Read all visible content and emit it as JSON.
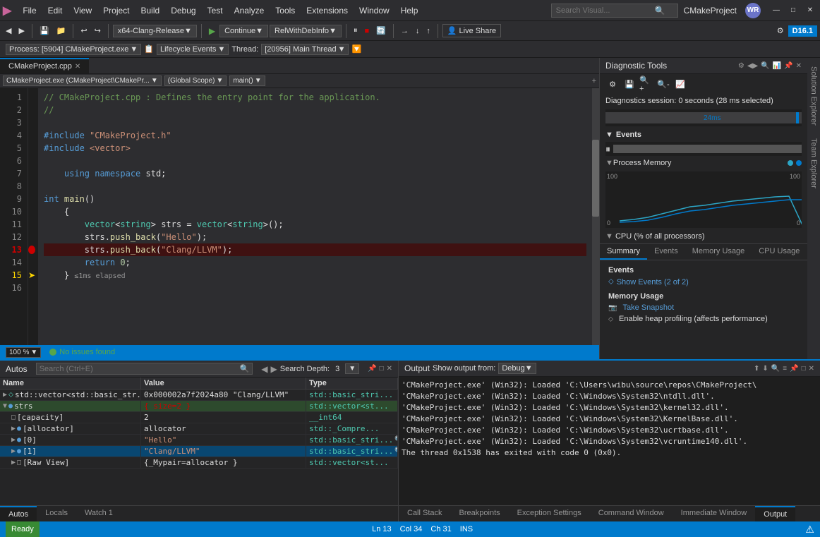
{
  "app": {
    "logo": "▶",
    "title": "CMakeProject",
    "user_initials": "WR"
  },
  "menu": {
    "items": [
      "File",
      "Edit",
      "View",
      "Project",
      "Build",
      "Debug",
      "Test",
      "Analyze",
      "Tools",
      "Extensions",
      "Window",
      "Help"
    ]
  },
  "search": {
    "placeholder": "Search Visual...",
    "value": ""
  },
  "toolbar": {
    "platform": "x64-Clang-Release",
    "continue": "Continue",
    "rel_with_deb": "RelWithDebInfo",
    "live_share": "Live Share",
    "d16": "D16.1"
  },
  "process_bar": {
    "process": "Process: [5904] CMakeProject.exe",
    "lifecycle": "Lifecycle Events",
    "thread_label": "Thread:",
    "thread": "[20956] Main Thread"
  },
  "editor": {
    "tab_name": "CMakeProject.cpp",
    "file_path": "CMakeProject.exe (CMakeProject\\CMakePr...",
    "scope": "(Global Scope)",
    "func": "main()",
    "lines": [
      {
        "num": 1,
        "text": "// CMakeProject.cpp : Defines the entry point for the application.",
        "type": "comment"
      },
      {
        "num": 2,
        "text": "//",
        "type": "comment"
      },
      {
        "num": 3,
        "text": "",
        "type": "normal"
      },
      {
        "num": 4,
        "text": "#include \"CMakeProject.h\"",
        "type": "include"
      },
      {
        "num": 5,
        "text": "#include <vector>",
        "type": "include"
      },
      {
        "num": 6,
        "text": "",
        "type": "normal"
      },
      {
        "num": 7,
        "text": "    using namespace std;",
        "type": "normal"
      },
      {
        "num": 8,
        "text": "",
        "type": "normal"
      },
      {
        "num": 9,
        "text": "int main()",
        "type": "normal"
      },
      {
        "num": 10,
        "text": "    {",
        "type": "normal"
      },
      {
        "num": 11,
        "text": "        vector<string> strs = vector<string>();",
        "type": "normal"
      },
      {
        "num": 12,
        "text": "        strs.push_back(\"Hello\");",
        "type": "normal"
      },
      {
        "num": 13,
        "text": "        strs.push_back(\"Clang/LLVM\");",
        "type": "breakpoint"
      },
      {
        "num": 14,
        "text": "        return 0;",
        "type": "normal"
      },
      {
        "num": 15,
        "text": "    } ≤1ms elapsed",
        "type": "timing"
      },
      {
        "num": 16,
        "text": "",
        "type": "normal"
      }
    ],
    "zoom": "100 %",
    "status": "No issues found",
    "ln": "Ln 13",
    "col": "Col 34",
    "ch": "Ch 31",
    "ins": "INS"
  },
  "diagnostic": {
    "title": "Diagnostic Tools",
    "session": "Diagnostics session: 0 seconds (28 ms selected)",
    "time_marker": "24ms",
    "events_section": "Events",
    "process_memory_section": "Process Memory",
    "cpu_section": "CPU (% of all processors)",
    "mem_high_left": "100",
    "mem_low_left": "0",
    "mem_high_right": "100",
    "mem_low_right": "0",
    "tabs": [
      "Summary",
      "Events",
      "Memory Usage",
      "CPU Usage"
    ],
    "active_tab": "Summary",
    "events_label": "Events",
    "show_events": "Show Events (2 of 2)",
    "memory_usage_label": "Memory Usage",
    "take_snapshot": "Take Snapshot",
    "enable_heap": "Enable heap profiling (affects performance)"
  },
  "autos": {
    "title": "Autos",
    "search_placeholder": "Search (Ctrl+E)",
    "search_depth_label": "Search Depth:",
    "search_depth_value": "3",
    "columns": [
      "Name",
      "Value",
      "Type"
    ],
    "rows": [
      {
        "indent": 0,
        "expand": true,
        "icon": "ptr",
        "name": "std::vector<std::basic_str...",
        "value": "0x000002a7f2024a80 \"Clang/LLVM\"",
        "type": "std::basic_stri...",
        "has_search": true,
        "selected": false,
        "highlighted": false
      },
      {
        "indent": 0,
        "expand": true,
        "icon": "obj",
        "name": "strs",
        "value": "{ size=2 }",
        "type": "std::vector<st...",
        "has_search": false,
        "selected": false,
        "highlighted": true
      },
      {
        "indent": 1,
        "expand": false,
        "icon": "item",
        "name": "[capacity]",
        "value": "2",
        "type": "__int64",
        "has_search": false,
        "selected": false,
        "highlighted": false
      },
      {
        "indent": 1,
        "expand": false,
        "icon": "obj",
        "name": "[allocator]",
        "value": "allocator",
        "type": "std::_Compre...",
        "has_search": false,
        "selected": false,
        "highlighted": false
      },
      {
        "indent": 1,
        "expand": false,
        "icon": "obj",
        "name": "[0]",
        "value": "\"Hello\"",
        "type": "std::basic_stri...",
        "has_search": true,
        "selected": false,
        "highlighted": false
      },
      {
        "indent": 1,
        "expand": false,
        "icon": "obj",
        "name": "[1]",
        "value": "\"Clang/LLVM\"",
        "type": "std::basic_stri...",
        "has_search": true,
        "selected": true,
        "highlighted": false
      },
      {
        "indent": 1,
        "expand": false,
        "icon": "item",
        "name": "[Raw View]",
        "value": "{_Mypair=allocator }",
        "type": "std::vector<st...",
        "has_search": false,
        "selected": false,
        "highlighted": false
      }
    ],
    "bottom_tabs": [
      "Autos",
      "Locals",
      "Watch 1"
    ]
  },
  "output": {
    "title": "Output",
    "show_from_label": "Show output from:",
    "source": "Debug",
    "lines": [
      "'CMakeProject.exe' (Win32): Loaded 'C:\\Users\\wibu\\source\\repos\\CMakeProject\\",
      "'CMakeProject.exe' (Win32): Loaded 'C:\\Windows\\System32\\ntdll.dll'.",
      "'CMakeProject.exe' (Win32): Loaded 'C:\\Windows\\System32\\kernel32.dll'.",
      "'CMakeProject.exe' (Win32): Loaded 'C:\\Windows\\System32\\KernelBase.dll'.",
      "'CMakeProject.exe' (Win32): Loaded 'C:\\Windows\\System32\\ucrtbase.dll'.",
      "'CMakeProject.exe' (Win32): Loaded 'C:\\Windows\\System32\\vcruntime140.dll'.",
      "The thread 0x1538 has exited with code 0 (0x0)."
    ],
    "bottom_tabs": [
      "Call Stack",
      "Breakpoints",
      "Exception Settings",
      "Command Window",
      "Immediate Window",
      "Output"
    ]
  },
  "status_bar": {
    "ready": "Ready",
    "ln": "Ln 13",
    "col": "Col 34",
    "ch": "Ch 31",
    "ins": "INS"
  },
  "side_panels": {
    "solution_explorer": "Solution Explorer",
    "team_explorer": "Team Explorer"
  }
}
